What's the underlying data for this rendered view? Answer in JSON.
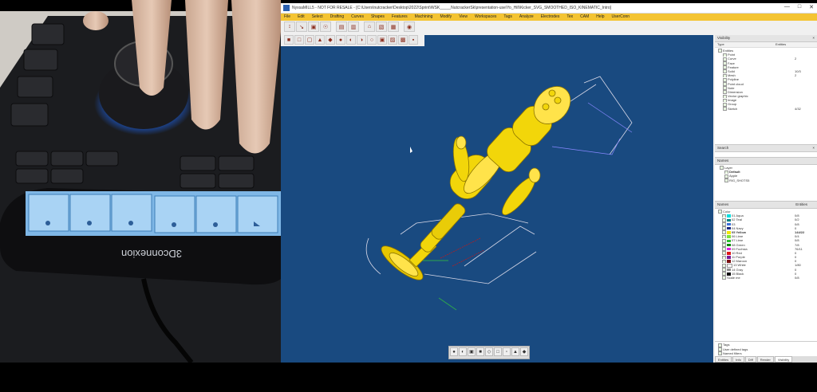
{
  "window": {
    "title": "NyxsaMILL5 - NOT FOR RESALE - [C:\\Users\\nutcracker\\Desktop\\2022\\Sprint\\WSK_____NutcrackerSk\\presentation-use\\Yo_Hill\\Kicker_SVG_SMOOTHED_ISO_KINEMATIC_Intro]",
    "controls": [
      "—",
      "□",
      "✕"
    ]
  },
  "menu": [
    "File",
    "Edit",
    "Select",
    "Drafting",
    "Curves",
    "Shapes",
    "Features",
    "Machining",
    "Modify",
    "View",
    "Workspaces",
    "Tags",
    "Analyze",
    "Electrodes",
    "Tex",
    "CAM",
    "Help",
    "UserConn"
  ],
  "toolbar_row1": [
    "↕",
    "↘",
    "▣",
    "☉",
    "▤",
    "▥",
    "⌂",
    "▧",
    "▦",
    "◉"
  ],
  "toolbar_row2": [
    "■",
    "□",
    "▢",
    "▲",
    "◆",
    "●",
    "◐",
    "◑",
    "○",
    "▣",
    "▨",
    "▩",
    "▪",
    "▫",
    "▬"
  ],
  "view_toolbar": [
    "●",
    "◐",
    "▣",
    "■",
    "◇",
    "□",
    "▫",
    "▲",
    "◆"
  ],
  "device": {
    "brand": "3Dconnexion",
    "lcd_rows": [
      [
        "",
        "",
        ""
      ],
      [
        "",
        "",
        ""
      ]
    ]
  },
  "panels": {
    "visibility": {
      "title": "Visibility",
      "col_type": "Type",
      "col_entities": "Entities",
      "items": [
        {
          "name": "Entities",
          "value": ""
        },
        {
          "name": "Point",
          "value": ""
        },
        {
          "name": "Curve",
          "value": "2"
        },
        {
          "name": "Face",
          "value": ""
        },
        {
          "name": "Feature",
          "value": ""
        },
        {
          "name": "Solid",
          "value": "10/3"
        },
        {
          "name": "Mesh",
          "value": "2"
        },
        {
          "name": "Polyline",
          "value": ""
        },
        {
          "name": "Point cloud",
          "value": ""
        },
        {
          "name": "Note",
          "value": ""
        },
        {
          "name": "Dimension",
          "value": ""
        },
        {
          "name": "Vector graphic",
          "value": ""
        },
        {
          "name": "Image",
          "value": ""
        },
        {
          "name": "Group",
          "value": ""
        },
        {
          "name": "Sketch",
          "value": "4/32"
        }
      ]
    },
    "search": {
      "title": "Search"
    },
    "layers": {
      "title": "Names",
      "items": [
        "Layer",
        "Default",
        "Apple",
        "RIG_SHOTS5"
      ]
    },
    "colors": {
      "title": "Names",
      "col_entities": "Entities",
      "items": [
        {
          "name": "Color",
          "value": "",
          "color": ""
        },
        {
          "name": "01 Aqua",
          "value": "0/8",
          "color": "#00e0e0"
        },
        {
          "name": "02 Teal",
          "value": "0/2",
          "color": "#008080"
        },
        {
          "name": "03",
          "value": "0/8",
          "color": "#3a6fd8"
        },
        {
          "name": "04 Navy",
          "value": "0",
          "color": "#1a2a80"
        },
        {
          "name": "05 Yellow",
          "value": "144/22",
          "color": "#f2e600"
        },
        {
          "name": "06 Lime",
          "value": "0/4",
          "color": "#7be23a"
        },
        {
          "name": "07 Lime",
          "value": "0/8",
          "color": "#2ebd2e"
        },
        {
          "name": "08 Green",
          "value": "7/8",
          "color": "#0a8a0a"
        },
        {
          "name": "09 Fuchsia",
          "value": "76/11",
          "color": "#e020e0"
        },
        {
          "name": "10 Red",
          "value": "0",
          "color": "#e01818"
        },
        {
          "name": "11 Purple",
          "value": "0",
          "color": "#7a1a9a"
        },
        {
          "name": "12 Maroon",
          "value": "0",
          "color": "#7a1010"
        },
        {
          "name": "13 White",
          "value": "1/80",
          "color": "#ffffff"
        },
        {
          "name": "14 Gray",
          "value": "0",
          "color": "#909090"
        },
        {
          "name": "15 Black",
          "value": "0",
          "color": "#101010"
        },
        {
          "name": "Scale me",
          "value": "0/8",
          "color": ""
        }
      ]
    },
    "extra": {
      "items": [
        "Tags",
        "User defined tags",
        "Named filters"
      ]
    },
    "tabs": [
      "Entities",
      "Info",
      "Diff",
      "Render",
      "Visibility"
    ]
  },
  "colors": {
    "viewport_bg": "#194a80",
    "model_yellow": "#f2d60a",
    "dimension_white": "#e6e6ea",
    "dimension_red": "#d02020",
    "menu_bar": "#f4c433"
  }
}
